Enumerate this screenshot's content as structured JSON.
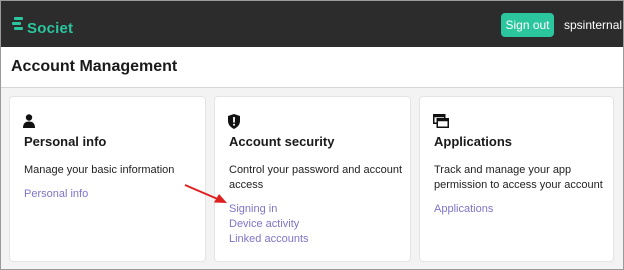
{
  "header": {
    "logo_text": "Societ",
    "sign_out_label": "Sign out",
    "username": "spsinternal",
    "accent_color": "#2bc59e"
  },
  "page": {
    "title": "Account Management"
  },
  "cards": [
    {
      "icon": "person-icon",
      "title": "Personal info",
      "description": "Manage your basic information",
      "links": [
        "Personal info"
      ]
    },
    {
      "icon": "shield-alert-icon",
      "title": "Account security",
      "description": "Control your password and account access",
      "links": [
        "Signing in",
        "Device activity",
        "Linked accounts"
      ]
    },
    {
      "icon": "windows-icon",
      "title": "Applications",
      "description": "Track and manage your app permission to access your account",
      "links": [
        "Applications"
      ]
    }
  ],
  "annotation": {
    "arrow_color": "#e02020",
    "points_to": "Signing in"
  }
}
